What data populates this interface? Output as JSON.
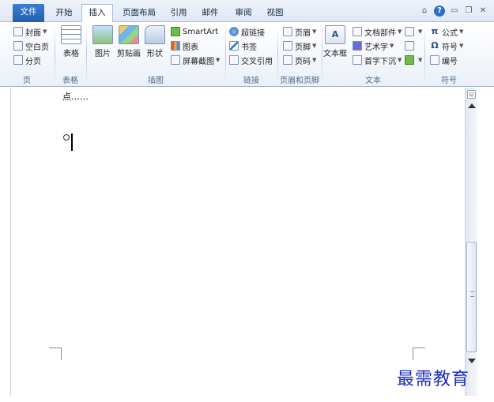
{
  "tabs": [
    {
      "label": "文件"
    },
    {
      "label": "开始"
    },
    {
      "label": "插入"
    },
    {
      "label": "页面布局"
    },
    {
      "label": "引用"
    },
    {
      "label": "邮件"
    },
    {
      "label": "审阅"
    },
    {
      "label": "视图"
    }
  ],
  "active_tab": "插入",
  "ribbon": {
    "pages": {
      "items": [
        "封面",
        "空白页",
        "分页"
      ],
      "label": "页"
    },
    "tables": {
      "item": "表格",
      "label": "表格"
    },
    "illustrations": {
      "picture": "图片",
      "clipart": "剪贴画",
      "shapes": "形状",
      "smartart": "SmartArt",
      "chart": "图表",
      "screenshot": "屏幕截图",
      "label": "插图"
    },
    "links": {
      "items": [
        "超链接",
        "书签",
        "交叉引用"
      ],
      "label": "链接"
    },
    "header_footer": {
      "items": [
        "页眉",
        "页脚",
        "页码"
      ],
      "label": "页眉和页脚"
    },
    "text": {
      "textbox": "文本框",
      "quickparts": "文档部件",
      "wordart": "艺术字",
      "dropcap": "首字下沉",
      "label": "文本"
    },
    "symbols": {
      "items": [
        "公式",
        "符号",
        "编号"
      ],
      "label": "符号"
    }
  },
  "document": {
    "text": "点……"
  },
  "watermark": "最需教育"
}
